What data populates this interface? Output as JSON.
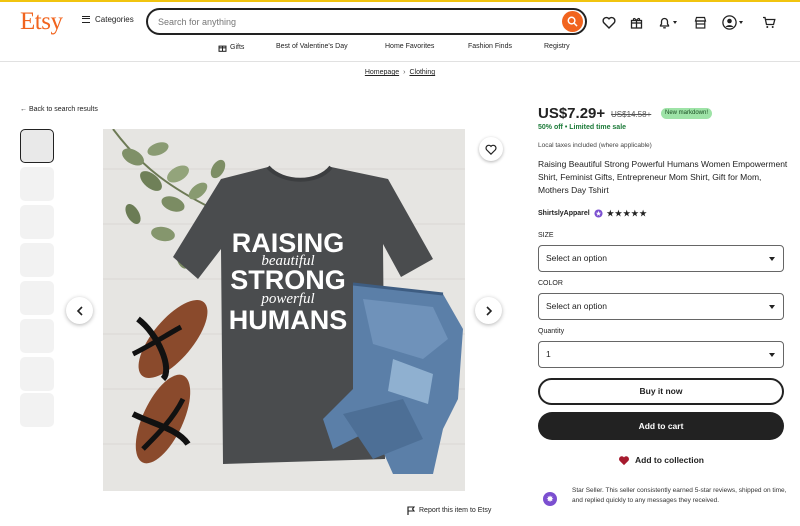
{
  "header": {
    "logo": "Etsy",
    "categories_label": "Categories",
    "search_placeholder": "Search for anything"
  },
  "nav": {
    "items": [
      "Gifts",
      "Best of Valentine's Day",
      "Home Favorites",
      "Fashion Finds",
      "Registry"
    ]
  },
  "breadcrumb": {
    "items": [
      "Homepage",
      "Clothing"
    ]
  },
  "back_link": "Back to search results",
  "product": {
    "price": "US$7.29+",
    "old_price": "US$14.58+",
    "badge": "New markdown!",
    "sale_text": "50% off • Limited time sale",
    "tax_note": "Local taxes included (where applicable)",
    "title": "Raising Beautiful Strong Powerful Humans Women Empowerment Shirt, Feminist Gifts, Entrepreneur Mom Shirt, Gift for Mom, Mothers Day Tshirt",
    "shop_name": "ShirtslyApparel",
    "rating_stars": "★★★★★",
    "rating": 5,
    "image_text": [
      "RAISING",
      "beautiful",
      "STRONG",
      "powerful",
      "HUMANS"
    ]
  },
  "options": {
    "size_label": "SIZE",
    "size_value": "Select an option",
    "color_label": "COLOR",
    "color_value": "Select an option",
    "quantity_label": "Quantity",
    "quantity_value": "1"
  },
  "actions": {
    "buy_now": "Buy it now",
    "add_to_cart": "Add to cart",
    "add_to_collection": "Add to collection",
    "report": "Report this item to Etsy"
  },
  "star_seller": {
    "text": "Star Seller. This seller consistently earned 5-star reviews, shipped on time, and replied quickly to any messages they received."
  },
  "colors": {
    "brand": "#f1641e",
    "sale_green": "#1b7a38",
    "badge_bg": "#9ee3a7",
    "star_seller_purple": "#7b4fd0"
  }
}
